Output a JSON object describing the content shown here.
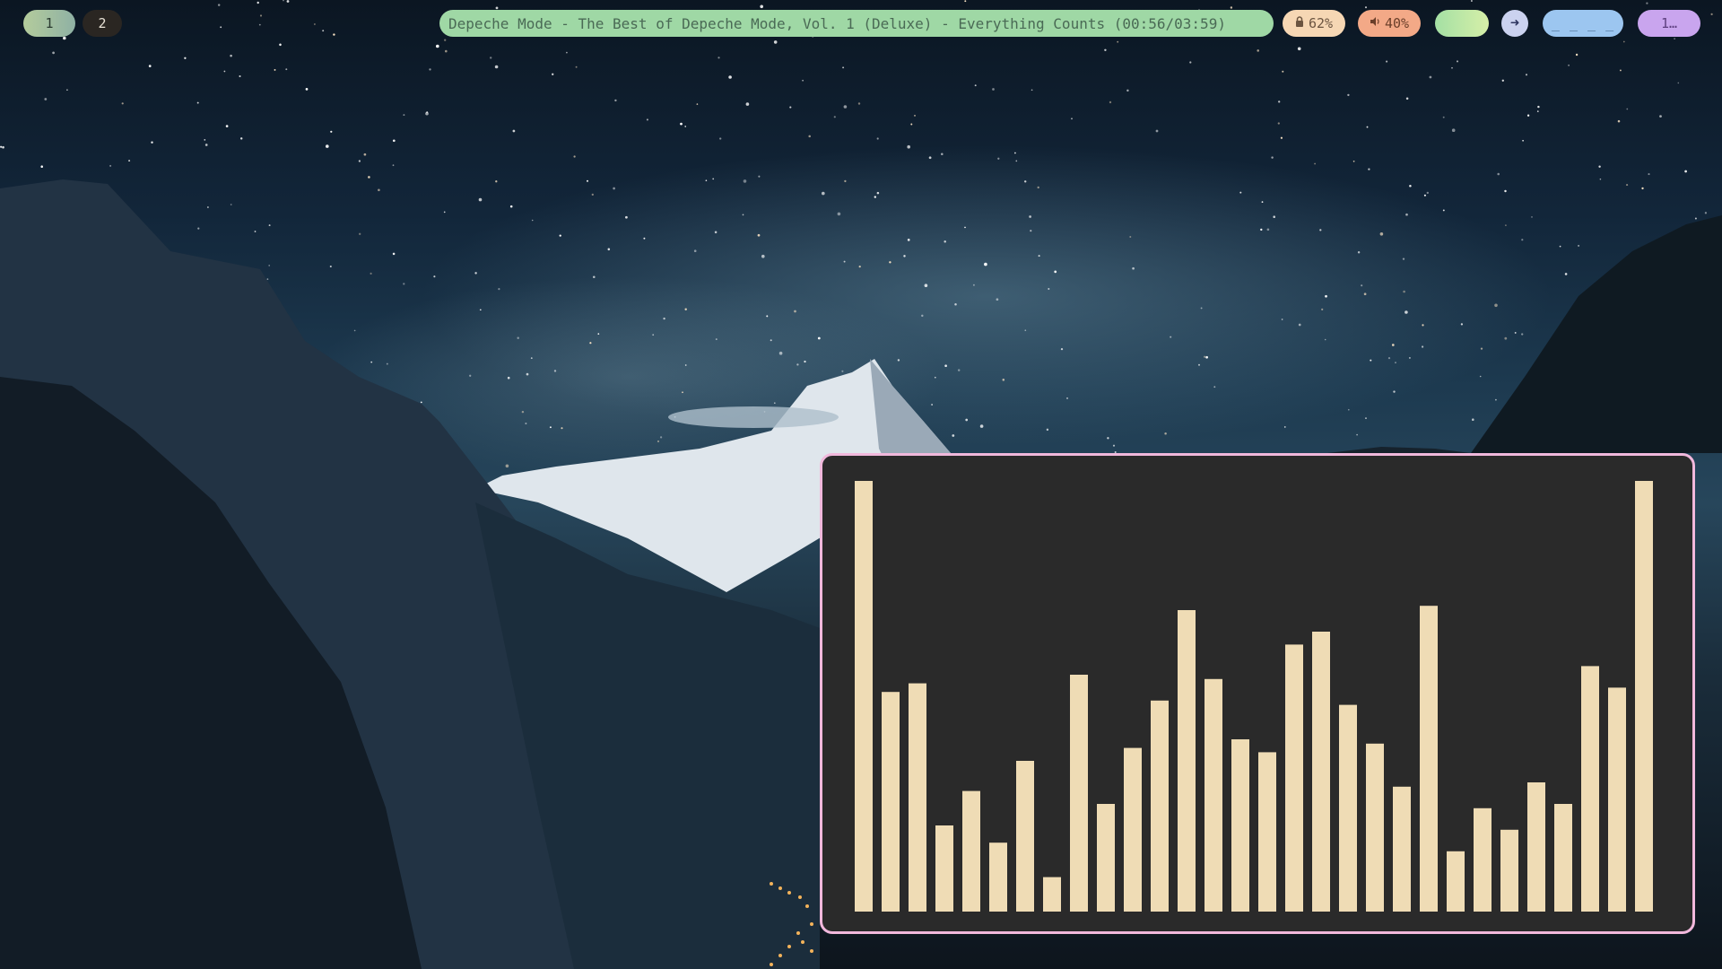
{
  "topbar": {
    "workspaces": [
      {
        "label": "1",
        "active": true
      },
      {
        "label": "2",
        "active": false
      }
    ],
    "now_playing": "Depeche Mode - The Best of Depeche Mode, Vol. 1 (Deluxe) - Everything Counts (00:56/03:59)",
    "battery": {
      "icon": "lock-icon",
      "value": "62%"
    },
    "volume": {
      "icon": "speaker-icon",
      "value": "40%"
    },
    "arrow": {
      "icon": "arrow-right-icon",
      "glyph": "➜"
    },
    "network": "_ _ _ _",
    "clock": "1…"
  },
  "visualizer": {
    "bar_color": "#efdcb5",
    "background": "#2a2a2a",
    "border_color": "#f1b8dc",
    "levels": [
      1.0,
      0.51,
      0.53,
      0.2,
      0.28,
      0.16,
      0.35,
      0.08,
      0.55,
      0.25,
      0.38,
      0.49,
      0.7,
      0.54,
      0.4,
      0.37,
      0.62,
      0.65,
      0.48,
      0.39,
      0.29,
      0.71,
      0.14,
      0.24,
      0.19,
      0.3,
      0.25,
      0.57,
      0.52,
      1.0
    ]
  },
  "colors": {
    "workspace_active": "#b4cc9c",
    "now_playing_bg": "#9fd8a5",
    "battery_bg": "#f6d7b4",
    "volume_bg": "#f3a987",
    "network_bg": "#9cc6f0",
    "clock_bg": "#c9a5ee"
  }
}
